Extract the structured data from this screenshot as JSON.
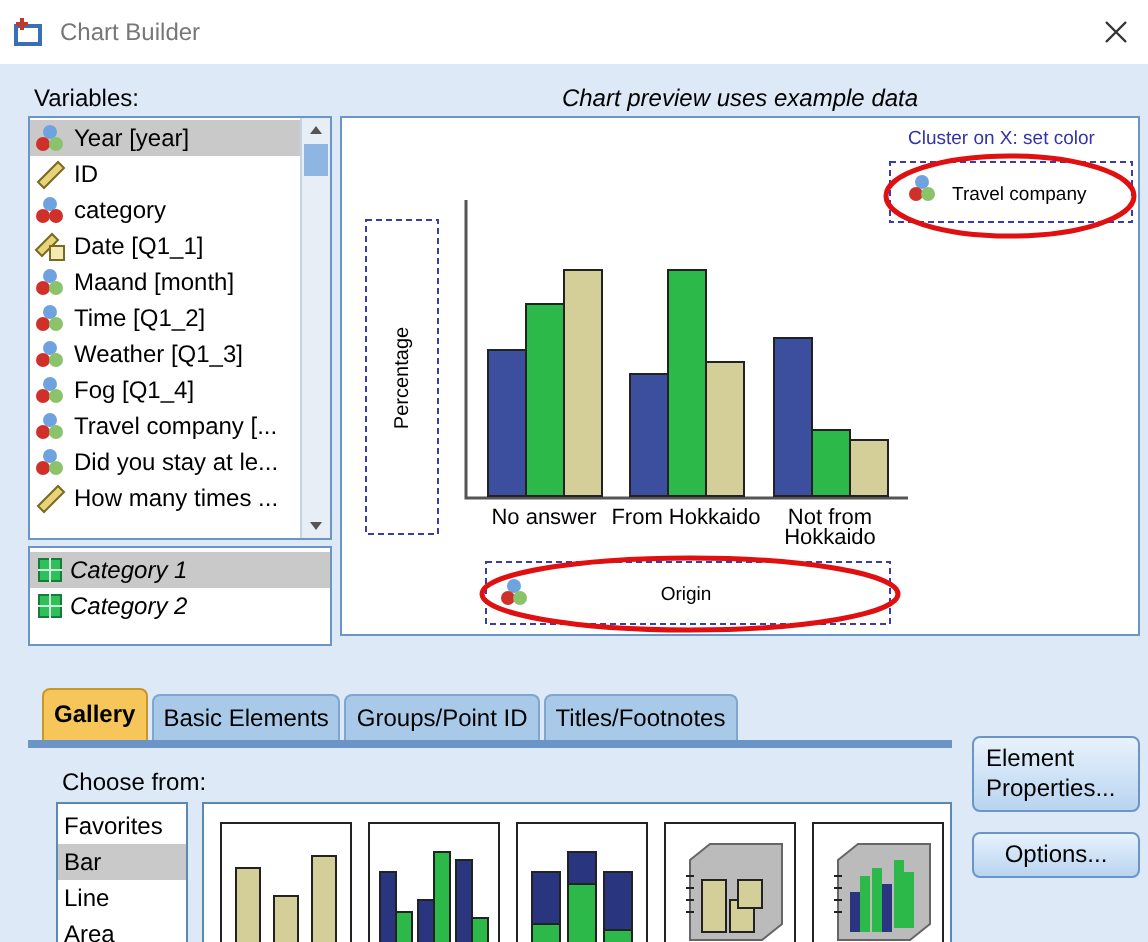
{
  "window": {
    "title": "Chart Builder"
  },
  "variables": {
    "label": "Variables:",
    "items": [
      {
        "name": "Year [year]",
        "kind": "nominal",
        "selected": true
      },
      {
        "name": "ID",
        "kind": "scale",
        "selected": false
      },
      {
        "name": "category",
        "kind": "string",
        "selected": false
      },
      {
        "name": "Date [Q1_1]",
        "kind": "date",
        "selected": false
      },
      {
        "name": "Maand [month]",
        "kind": "nominal",
        "selected": false
      },
      {
        "name": "Time [Q1_2]",
        "kind": "nominal",
        "selected": false
      },
      {
        "name": "Weather [Q1_3]",
        "kind": "nominal",
        "selected": false
      },
      {
        "name": "Fog [Q1_4]",
        "kind": "nominal",
        "selected": false
      },
      {
        "name": "Travel company [...",
        "kind": "nominal",
        "selected": false
      },
      {
        "name": "Did you stay at le...",
        "kind": "nominal",
        "selected": false
      },
      {
        "name": "How many times ...",
        "kind": "scale",
        "selected": false
      }
    ]
  },
  "categories": [
    {
      "label": "Category 1",
      "selected": true
    },
    {
      "label": "Category 2",
      "selected": false
    }
  ],
  "preview": {
    "note": "Chart preview uses example data",
    "y_zone": "Percentage",
    "x_zone": "Origin",
    "cluster_hint": "Cluster on X: set color",
    "cluster_zone": "Travel company",
    "x_labels": [
      {
        "lines": [
          "No answer"
        ]
      },
      {
        "lines": [
          "From Hokkaido"
        ]
      },
      {
        "lines": [
          "Not from",
          "Hokkaido"
        ]
      }
    ]
  },
  "tabs": [
    {
      "label": "Gallery",
      "selected": true
    },
    {
      "label": "Basic Elements",
      "selected": false
    },
    {
      "label": "Groups/Point ID",
      "selected": false
    },
    {
      "label": "Titles/Footnotes",
      "selected": false
    }
  ],
  "gallery": {
    "label": "Choose from:",
    "types": [
      {
        "label": "Favorites",
        "selected": false
      },
      {
        "label": "Bar",
        "selected": true
      },
      {
        "label": "Line",
        "selected": false
      },
      {
        "label": "Area",
        "selected": false
      }
    ],
    "thumbnails": [
      {
        "kind": "simple"
      },
      {
        "kind": "clustered"
      },
      {
        "kind": "stacked"
      },
      {
        "kind": "simple3d"
      },
      {
        "kind": "clustered3d"
      }
    ]
  },
  "buttons": [
    {
      "lines": [
        "Element",
        "Properties..."
      ]
    },
    {
      "lines": [
        "Options..."
      ]
    }
  ]
}
